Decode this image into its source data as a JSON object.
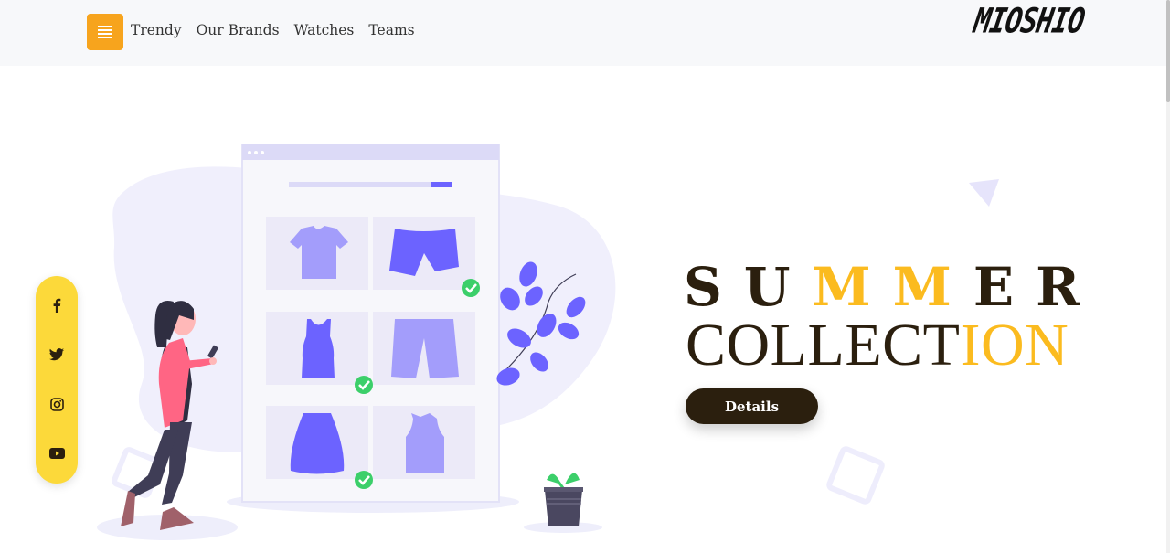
{
  "header": {
    "menu_icon": "hamburger-icon",
    "nav": [
      "Trendy",
      "Our Brands",
      "Watches",
      "Teams"
    ],
    "logo_text": "MIOSHIO"
  },
  "social": [
    "facebook-icon",
    "twitter-icon",
    "instagram-icon",
    "youtube-icon"
  ],
  "hero": {
    "line1_prefix": "SU",
    "line1_highlight": "MM",
    "line1_suffix": "ER",
    "line2_prefix": "COLLECT",
    "line2_highlight": "ION",
    "button_label": "Details"
  },
  "colors": {
    "accent": "#fbbb1f",
    "menu_button": "#f7a41d",
    "dark": "#2b1f0e",
    "social_bar": "#fcd93a",
    "illustration_purple": "#6c63ff"
  }
}
